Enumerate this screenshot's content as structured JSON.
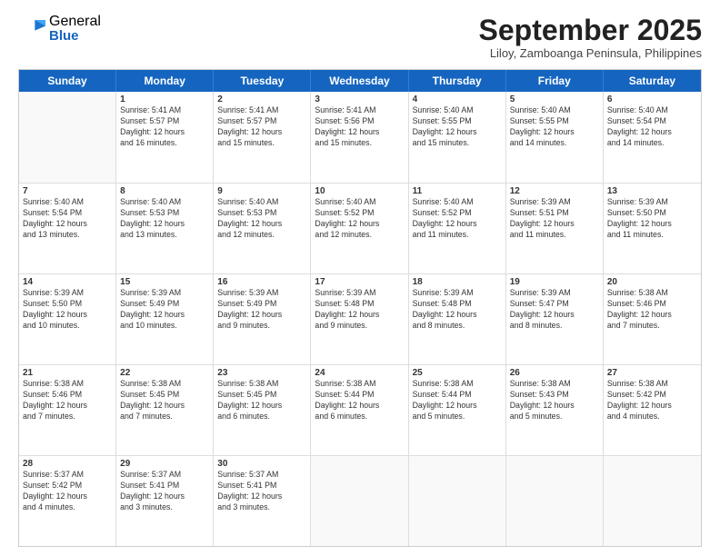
{
  "logo": {
    "general": "General",
    "blue": "Blue"
  },
  "header": {
    "month": "September 2025",
    "location": "Liloy, Zamboanga Peninsula, Philippines"
  },
  "days": [
    "Sunday",
    "Monday",
    "Tuesday",
    "Wednesday",
    "Thursday",
    "Friday",
    "Saturday"
  ],
  "weeks": [
    [
      {
        "date": "",
        "sunrise": "",
        "sunset": "",
        "daylight": ""
      },
      {
        "date": "1",
        "sunrise": "Sunrise: 5:41 AM",
        "sunset": "Sunset: 5:57 PM",
        "daylight": "Daylight: 12 hours and 16 minutes."
      },
      {
        "date": "2",
        "sunrise": "Sunrise: 5:41 AM",
        "sunset": "Sunset: 5:57 PM",
        "daylight": "Daylight: 12 hours and 15 minutes."
      },
      {
        "date": "3",
        "sunrise": "Sunrise: 5:41 AM",
        "sunset": "Sunset: 5:56 PM",
        "daylight": "Daylight: 12 hours and 15 minutes."
      },
      {
        "date": "4",
        "sunrise": "Sunrise: 5:40 AM",
        "sunset": "Sunset: 5:55 PM",
        "daylight": "Daylight: 12 hours and 15 minutes."
      },
      {
        "date": "5",
        "sunrise": "Sunrise: 5:40 AM",
        "sunset": "Sunset: 5:55 PM",
        "daylight": "Daylight: 12 hours and 14 minutes."
      },
      {
        "date": "6",
        "sunrise": "Sunrise: 5:40 AM",
        "sunset": "Sunset: 5:54 PM",
        "daylight": "Daylight: 12 hours and 14 minutes."
      }
    ],
    [
      {
        "date": "7",
        "sunrise": "Sunrise: 5:40 AM",
        "sunset": "Sunset: 5:54 PM",
        "daylight": "Daylight: 12 hours and 13 minutes."
      },
      {
        "date": "8",
        "sunrise": "Sunrise: 5:40 AM",
        "sunset": "Sunset: 5:53 PM",
        "daylight": "Daylight: 12 hours and 13 minutes."
      },
      {
        "date": "9",
        "sunrise": "Sunrise: 5:40 AM",
        "sunset": "Sunset: 5:53 PM",
        "daylight": "Daylight: 12 hours and 12 minutes."
      },
      {
        "date": "10",
        "sunrise": "Sunrise: 5:40 AM",
        "sunset": "Sunset: 5:52 PM",
        "daylight": "Daylight: 12 hours and 12 minutes."
      },
      {
        "date": "11",
        "sunrise": "Sunrise: 5:40 AM",
        "sunset": "Sunset: 5:52 PM",
        "daylight": "Daylight: 12 hours and 11 minutes."
      },
      {
        "date": "12",
        "sunrise": "Sunrise: 5:39 AM",
        "sunset": "Sunset: 5:51 PM",
        "daylight": "Daylight: 12 hours and 11 minutes."
      },
      {
        "date": "13",
        "sunrise": "Sunrise: 5:39 AM",
        "sunset": "Sunset: 5:50 PM",
        "daylight": "Daylight: 12 hours and 11 minutes."
      }
    ],
    [
      {
        "date": "14",
        "sunrise": "Sunrise: 5:39 AM",
        "sunset": "Sunset: 5:50 PM",
        "daylight": "Daylight: 12 hours and 10 minutes."
      },
      {
        "date": "15",
        "sunrise": "Sunrise: 5:39 AM",
        "sunset": "Sunset: 5:49 PM",
        "daylight": "Daylight: 12 hours and 10 minutes."
      },
      {
        "date": "16",
        "sunrise": "Sunrise: 5:39 AM",
        "sunset": "Sunset: 5:49 PM",
        "daylight": "Daylight: 12 hours and 9 minutes."
      },
      {
        "date": "17",
        "sunrise": "Sunrise: 5:39 AM",
        "sunset": "Sunset: 5:48 PM",
        "daylight": "Daylight: 12 hours and 9 minutes."
      },
      {
        "date": "18",
        "sunrise": "Sunrise: 5:39 AM",
        "sunset": "Sunset: 5:48 PM",
        "daylight": "Daylight: 12 hours and 8 minutes."
      },
      {
        "date": "19",
        "sunrise": "Sunrise: 5:39 AM",
        "sunset": "Sunset: 5:47 PM",
        "daylight": "Daylight: 12 hours and 8 minutes."
      },
      {
        "date": "20",
        "sunrise": "Sunrise: 5:38 AM",
        "sunset": "Sunset: 5:46 PM",
        "daylight": "Daylight: 12 hours and 7 minutes."
      }
    ],
    [
      {
        "date": "21",
        "sunrise": "Sunrise: 5:38 AM",
        "sunset": "Sunset: 5:46 PM",
        "daylight": "Daylight: 12 hours and 7 minutes."
      },
      {
        "date": "22",
        "sunrise": "Sunrise: 5:38 AM",
        "sunset": "Sunset: 5:45 PM",
        "daylight": "Daylight: 12 hours and 7 minutes."
      },
      {
        "date": "23",
        "sunrise": "Sunrise: 5:38 AM",
        "sunset": "Sunset: 5:45 PM",
        "daylight": "Daylight: 12 hours and 6 minutes."
      },
      {
        "date": "24",
        "sunrise": "Sunrise: 5:38 AM",
        "sunset": "Sunset: 5:44 PM",
        "daylight": "Daylight: 12 hours and 6 minutes."
      },
      {
        "date": "25",
        "sunrise": "Sunrise: 5:38 AM",
        "sunset": "Sunset: 5:44 PM",
        "daylight": "Daylight: 12 hours and 5 minutes."
      },
      {
        "date": "26",
        "sunrise": "Sunrise: 5:38 AM",
        "sunset": "Sunset: 5:43 PM",
        "daylight": "Daylight: 12 hours and 5 minutes."
      },
      {
        "date": "27",
        "sunrise": "Sunrise: 5:38 AM",
        "sunset": "Sunset: 5:42 PM",
        "daylight": "Daylight: 12 hours and 4 minutes."
      }
    ],
    [
      {
        "date": "28",
        "sunrise": "Sunrise: 5:37 AM",
        "sunset": "Sunset: 5:42 PM",
        "daylight": "Daylight: 12 hours and 4 minutes."
      },
      {
        "date": "29",
        "sunrise": "Sunrise: 5:37 AM",
        "sunset": "Sunset: 5:41 PM",
        "daylight": "Daylight: 12 hours and 3 minutes."
      },
      {
        "date": "30",
        "sunrise": "Sunrise: 5:37 AM",
        "sunset": "Sunset: 5:41 PM",
        "daylight": "Daylight: 12 hours and 3 minutes."
      },
      {
        "date": "",
        "sunrise": "",
        "sunset": "",
        "daylight": ""
      },
      {
        "date": "",
        "sunrise": "",
        "sunset": "",
        "daylight": ""
      },
      {
        "date": "",
        "sunrise": "",
        "sunset": "",
        "daylight": ""
      },
      {
        "date": "",
        "sunrise": "",
        "sunset": "",
        "daylight": ""
      }
    ]
  ]
}
